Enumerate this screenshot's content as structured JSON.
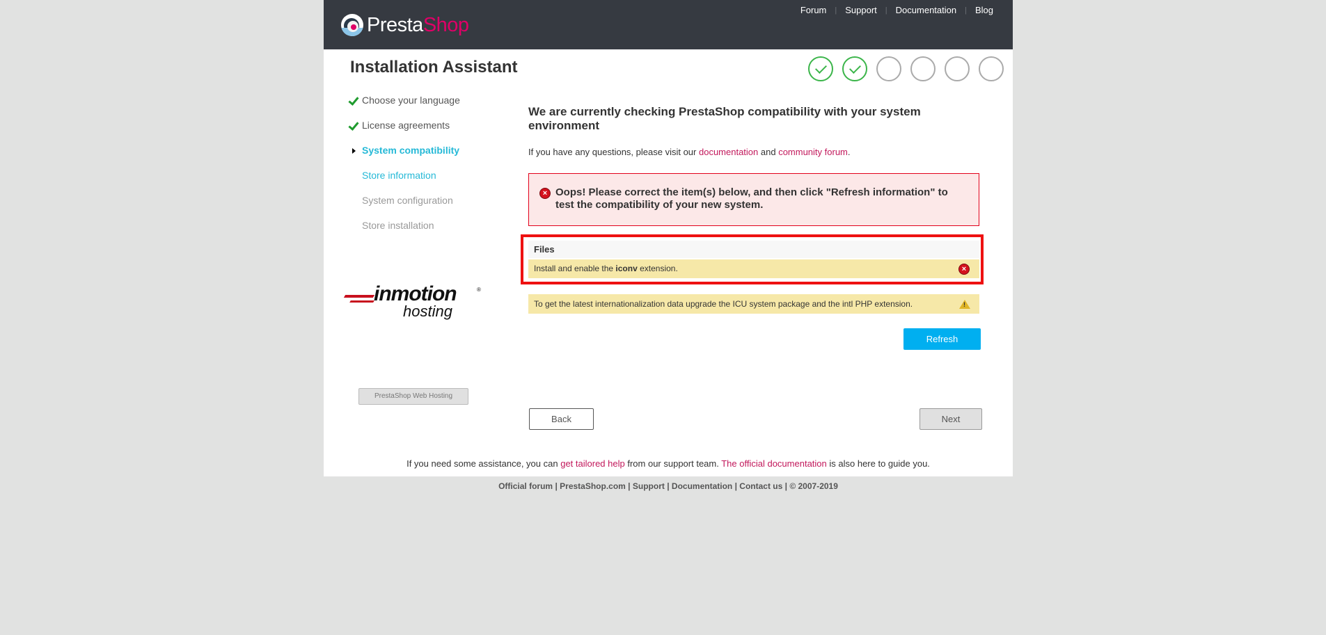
{
  "header": {
    "logo": {
      "text_presta": "Presta",
      "text_shop": "Shop"
    },
    "nav": [
      {
        "label": "Forum"
      },
      {
        "label": "Support"
      },
      {
        "label": "Documentation"
      },
      {
        "label": "Blog"
      }
    ]
  },
  "title": "Installation Assistant",
  "progress": {
    "total_steps": 6,
    "completed_steps": 2,
    "done_color": "#3bb54a"
  },
  "sidebar": {
    "items": [
      {
        "label": "Choose your language",
        "state": "done"
      },
      {
        "label": "License agreements",
        "state": "done"
      },
      {
        "label": "System compatibility",
        "state": "active"
      },
      {
        "label": "Store information",
        "state": "next"
      },
      {
        "label": "System configuration",
        "state": "todo"
      },
      {
        "label": "Store installation",
        "state": "todo"
      }
    ],
    "sponsor": {
      "logo_name": "inmotion",
      "logo_sub": "hosting",
      "logo_reg": "®",
      "button_label": "PrestaShop Web Hosting"
    }
  },
  "main": {
    "heading": "We are currently checking PrestaShop compatibility with your system environment",
    "intro_prefix": "If you have any questions, please visit our ",
    "intro_link1": "documentation",
    "intro_middle": " and ",
    "intro_link2": "community forum",
    "intro_suffix": ".",
    "error_message": "Oops! Please correct the item(s) below, and then click \"Refresh information\" to test the compatibility of your new system.",
    "files_section": {
      "header": "Files",
      "row_prefix": "Install and enable the ",
      "row_bold": "iconv",
      "row_suffix": " extension."
    },
    "warning_row": "To get the latest internationalization data upgrade the ICU system package and the intl PHP extension.",
    "refresh_label": "Refresh",
    "back_label": "Back",
    "next_label": "Next"
  },
  "help": {
    "prefix": "If you need some assistance, you can ",
    "link1": "get tailored help",
    "middle": " from our support team. ",
    "link2": "The official documentation",
    "suffix": " is also here to guide you."
  },
  "footer": {
    "links": [
      "Official forum",
      "PrestaShop.com",
      "Support",
      "Documentation",
      "Contact us"
    ],
    "copyright": "© 2007-2019",
    "separator": " | "
  },
  "colors": {
    "header_bg": "#363a41",
    "accent_pink": "#df0067",
    "link_pink": "#c2185b",
    "active_blue": "#25b9d7",
    "refresh_blue": "#00aff0",
    "error_red": "#e2001a",
    "error_bg": "#fce8e8",
    "warning_bg": "#f6e8a8",
    "page_bg": "#e1e2e1"
  }
}
